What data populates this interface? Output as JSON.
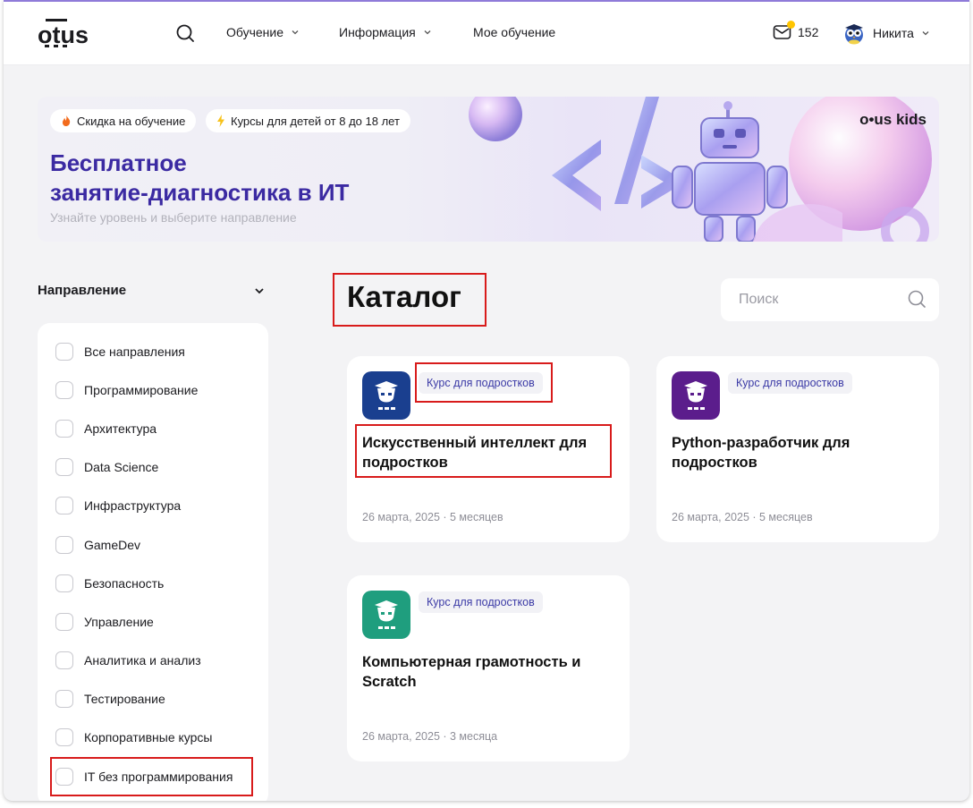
{
  "header": {
    "logo": {
      "o": "o",
      "t": "t",
      "us": "us"
    },
    "nav": [
      {
        "label": "Обучение",
        "has_dropdown": true
      },
      {
        "label": "Информация",
        "has_dropdown": true
      },
      {
        "label": "Мое обучение",
        "has_dropdown": false
      }
    ],
    "mail_count": "152",
    "user_name": "Никита"
  },
  "banner": {
    "pills": [
      {
        "icon": "fire-icon",
        "label": "Скидка на обучение"
      },
      {
        "icon": "lightning-icon",
        "label": "Курсы для детей от 8 до 18 лет"
      }
    ],
    "title_line1": "Бесплатное",
    "title_line2": "занятие-диагностика в ИТ",
    "subtitle": "Узнайте уровень и выберите направление",
    "kids_logo_a": "o",
    "kids_logo_b": "us kids"
  },
  "filter": {
    "heading": "Направление",
    "items": [
      "Все направления",
      "Программирование",
      "Архитектура",
      "Data Science",
      "Инфраструктура",
      "GameDev",
      "Безопасность",
      "Управление",
      "Аналитика и анализ",
      "Тестирование",
      "Корпоративные курсы",
      "IT без программирования"
    ]
  },
  "catalog": {
    "title": "Каталог",
    "search_placeholder": "Поиск",
    "cards": [
      {
        "badge": "Курс для подростков",
        "title": "Искусственный интеллект для подростков",
        "meta": "26 марта, 2025 · 5 месяцев",
        "icon_color": "#1a3f8f"
      },
      {
        "badge": "Курс для подростков",
        "title": "Python-разработчик для подростков",
        "meta": "26 марта, 2025 · 5 месяцев",
        "icon_color": "#5b1d8c"
      },
      {
        "badge": "Курс для подростков",
        "title": "Компьютерная грамотность и Scratch",
        "meta": "26 марта, 2025 · 3 месяца",
        "icon_color": "#1f9e7e"
      }
    ]
  },
  "colors": {
    "accent": "#3b2aa2",
    "highlight": "#d81b1b",
    "badge_text": "#3b3aa6"
  }
}
